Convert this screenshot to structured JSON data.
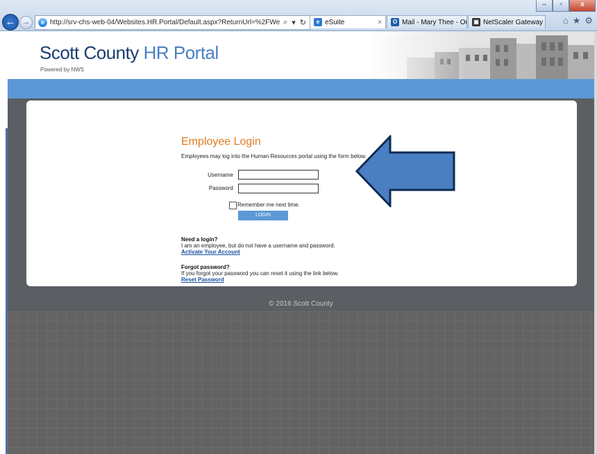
{
  "browser": {
    "address_url": "http://srv-chs-web-04/Websites.HR.Portal/Default.aspx?ReturnUrl=%2FWebsites.H",
    "tabs": [
      {
        "label": "eSuite",
        "active": true
      },
      {
        "label": "Mail - Mary Thee - Out...",
        "active": false
      },
      {
        "label": "NetScaler Gateway",
        "active": false
      }
    ]
  },
  "header": {
    "title_main": "Scott County ",
    "title_accent": "HR Portal",
    "subtitle": "Powered by NWS"
  },
  "login": {
    "title": "Employee Login",
    "description": "Employees may log into the Human Resources portal using the form below.",
    "username_label": "Username",
    "password_label": "Password",
    "username_value": "",
    "password_value": "",
    "remember_label": "Remember me next time.",
    "login_button": "LOGIN"
  },
  "need_login": {
    "heading": "Need a login?",
    "text": "I am an employee, but do not have a username and password.",
    "link": "Activate Your Account"
  },
  "forgot": {
    "heading": "Forgot password?",
    "text": "If you forgot your password you can reset it using the link below.",
    "link": "Reset Password"
  },
  "footer": {
    "text": "© 2016 Scott County"
  },
  "colors": {
    "brand_blue": "#5c98d6",
    "title_orange": "#e07a1f",
    "arrow_blue": "#4a7fc1"
  }
}
